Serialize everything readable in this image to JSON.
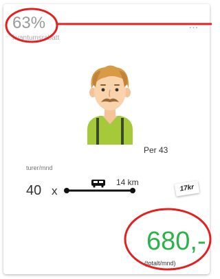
{
  "discount": {
    "percent": "63%",
    "label": "kvantumsrabatt"
  },
  "menu": {
    "icon": "more-icon",
    "glyph": "..."
  },
  "person": {
    "label": "Per 43",
    "avatar_icon": "person-avatar"
  },
  "trips": {
    "label": "turer/mnd",
    "value": "40",
    "multiplier": "x"
  },
  "route": {
    "distance": "14 km",
    "bus_icon": "bus-icon",
    "price_per_trip": "17kr"
  },
  "total": {
    "price": "680,-",
    "label": "(totalt/mnd)"
  },
  "colors": {
    "highlight": "#e32020",
    "price_green": "#2bb34a"
  }
}
